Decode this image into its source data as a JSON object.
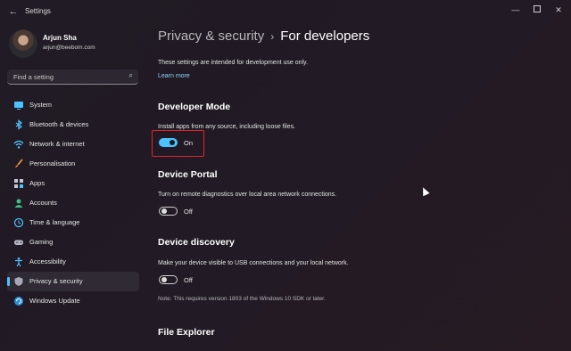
{
  "window": {
    "title": "Settings"
  },
  "user": {
    "name": "Arjun Sha",
    "email": "arjun@beebom.com"
  },
  "search": {
    "placeholder": "Find a setting"
  },
  "sidebar": {
    "items": [
      {
        "label": "System",
        "icon": "monitor-icon",
        "active": false
      },
      {
        "label": "Bluetooth & devices",
        "icon": "bluetooth-icon",
        "active": false
      },
      {
        "label": "Network & internet",
        "icon": "wifi-icon",
        "active": false
      },
      {
        "label": "Personalisation",
        "icon": "brush-icon",
        "active": false
      },
      {
        "label": "Apps",
        "icon": "apps-icon",
        "active": false
      },
      {
        "label": "Accounts",
        "icon": "person-icon",
        "active": false
      },
      {
        "label": "Time & language",
        "icon": "globe-clock-icon",
        "active": false
      },
      {
        "label": "Gaming",
        "icon": "gamepad-icon",
        "active": false
      },
      {
        "label": "Accessibility",
        "icon": "accessibility-icon",
        "active": false
      },
      {
        "label": "Privacy & security",
        "icon": "shield-icon",
        "active": true
      },
      {
        "label": "Windows Update",
        "icon": "update-icon",
        "active": false
      }
    ]
  },
  "breadcrumb": {
    "parent": "Privacy & security",
    "separator": "›",
    "current": "For developers"
  },
  "intro": {
    "text": "These settings are intended for development use only.",
    "link": "Learn more"
  },
  "sections": {
    "developer_mode": {
      "title": "Developer Mode",
      "description": "Install apps from any source, including loose files.",
      "state": "On"
    },
    "device_portal": {
      "title": "Device Portal",
      "description": "Turn on remote diagnostics over local area network connections.",
      "state": "Off"
    },
    "device_discovery": {
      "title": "Device discovery",
      "description": "Make your device visible to USB connections and your local network.",
      "state": "Off",
      "note": "Note: This requires version 1803 of the Windows 10 SDK or later."
    },
    "file_explorer": {
      "title": "File Explorer"
    }
  },
  "colors": {
    "accent": "#4cc2ff",
    "highlight": "#e0242b"
  }
}
